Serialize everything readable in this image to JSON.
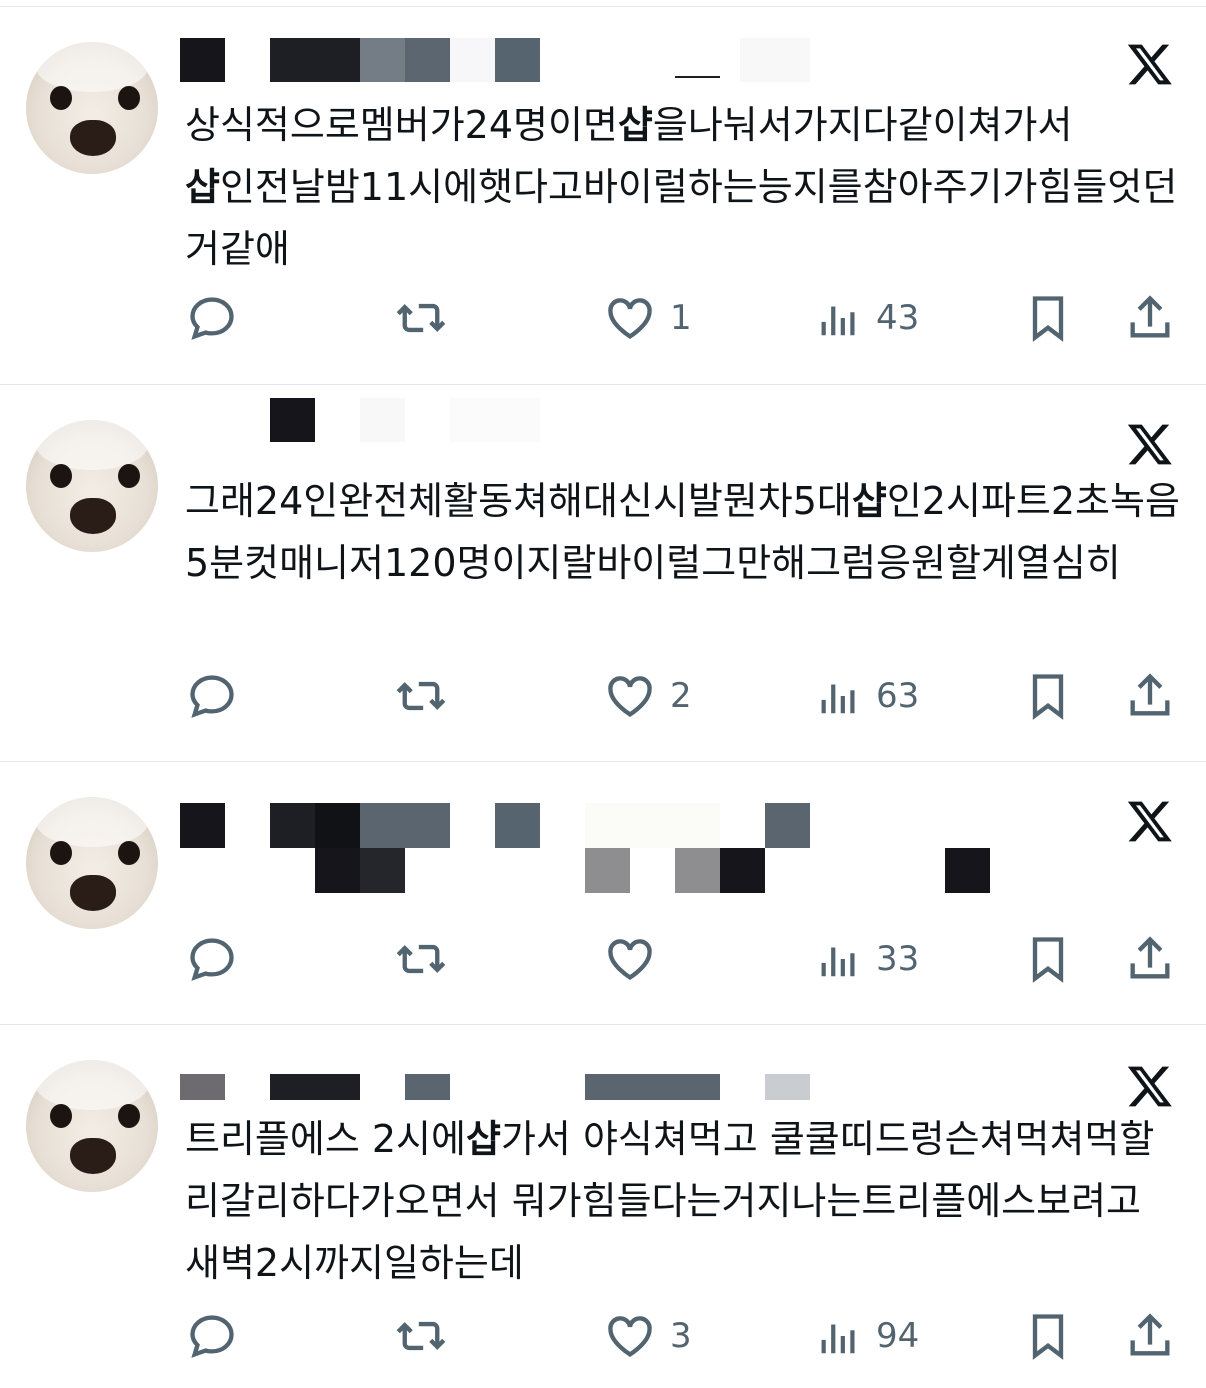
{
  "colors": {
    "text": "#0f1419",
    "icon": "#536471",
    "divider": "#e6e9ec",
    "brand": "#0f1419"
  },
  "posts": [
    {
      "text_parts": [
        "상식적으로멤버가24명이면",
        "샵",
        "을나눠서가지다같이쳐가서",
        "샵",
        "인전날밤11시에햇다고바이럴하는능지를참아주기가힘들엇던거같애"
      ],
      "actions": {
        "reply": "",
        "repost": "",
        "like": "1",
        "views": "43"
      }
    },
    {
      "text_parts": [
        "그래24인완전체활동쳐해대신시발뭔차5대",
        "샵",
        "인2시파트2초녹음5분컷매니저120명이지랄바이럴그만해그럼응원할게열심히"
      ],
      "actions": {
        "reply": "",
        "repost": "",
        "like": "2",
        "views": "63"
      }
    },
    {
      "text_parts": [],
      "actions": {
        "reply": "",
        "repost": "",
        "like": "",
        "views": "33"
      }
    },
    {
      "text_parts": [
        "트리플에스 2시에",
        "샵",
        "가서 야식쳐먹고 쿨쿨띠드렁슨쳐먹쳐먹할리갈리하다가오면서 뭐가힘들다는거지나는트리플에스보려고 새벽2시까지일하는데"
      ],
      "actions": {
        "reply": "",
        "repost": "",
        "like": "3",
        "views": "94"
      }
    }
  ],
  "icons": {
    "reply": "reply-icon",
    "repost": "repost-icon",
    "like": "heart-icon",
    "views": "views-icon",
    "bookmark": "bookmark-icon",
    "share": "share-icon",
    "platform": "x-logo-icon"
  }
}
